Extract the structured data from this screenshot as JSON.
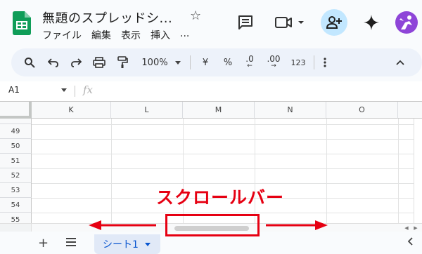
{
  "title": "無題のスプレッドシ...",
  "menu": [
    "ファイル",
    "編集",
    "表示",
    "挿入",
    "..."
  ],
  "toolbar": {
    "zoom": "100%",
    "currency": "¥",
    "percent": "%",
    "dec_decrease": ".0",
    "dec_increase": ".00",
    "number_format": "123"
  },
  "formula_bar": {
    "cell_ref": "A1",
    "fx": "fx"
  },
  "columns": [
    "K",
    "L",
    "M",
    "N",
    "O"
  ],
  "rows": [
    "49",
    "50",
    "51",
    "52",
    "53",
    "54",
    "55"
  ],
  "sheet_tab": "シート1",
  "annotation": "スクロールバー",
  "colors": {
    "accent": "#0b57d0",
    "annotation": "#e60012",
    "sheets_green": "#0f9d58"
  }
}
